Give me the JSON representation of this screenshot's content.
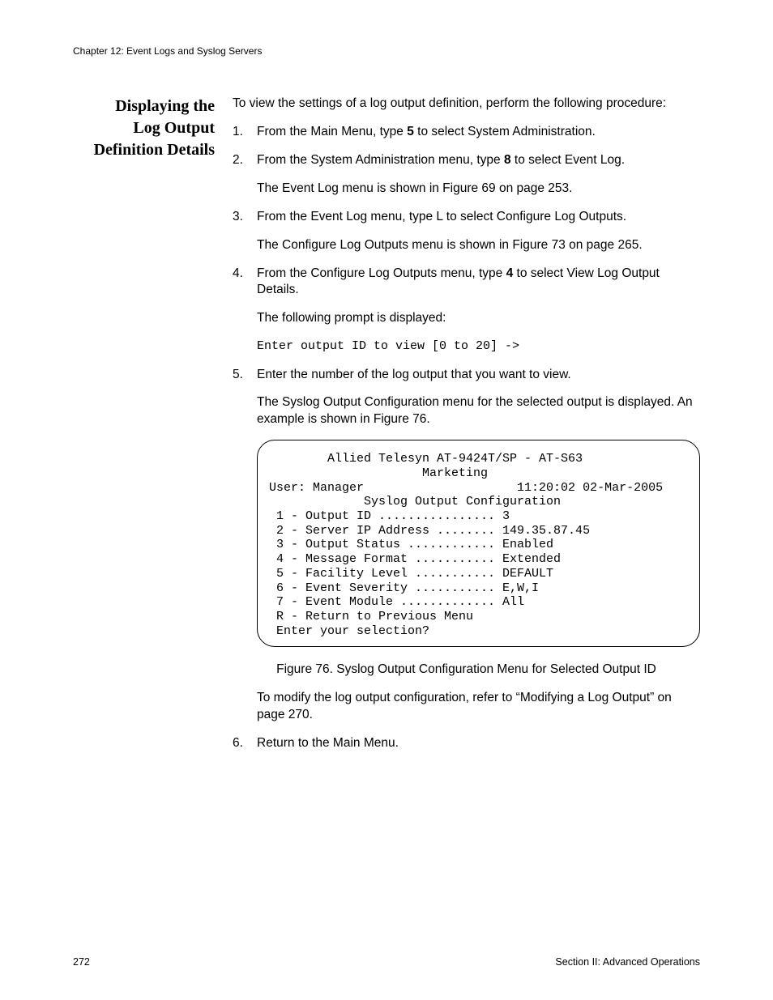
{
  "chapter_header": "Chapter 12: Event Logs and Syslog Servers",
  "sidehead_l1": "Displaying the",
  "sidehead_l2": "Log Output",
  "sidehead_l3": "Definition Details",
  "intro": "To view the settings of a log output definition, perform the following procedure:",
  "s1_num": "1.",
  "s1_a": "From the Main Menu, type ",
  "s1_b": "5",
  "s1_c": " to select System Administration.",
  "s2_num": "2.",
  "s2_a": "From the System Administration menu, type ",
  "s2_b": "8",
  "s2_c": " to select Event Log.",
  "s2_p2": "The Event Log menu is shown in Figure 69 on page 253.",
  "s3_num": "3.",
  "s3_p1": "From the Event Log menu, type L to select Configure Log Outputs.",
  "s3_p2": "The Configure Log Outputs menu is shown in Figure 73 on page 265.",
  "s4_num": "4.",
  "s4_a": "From the Configure Log Outputs menu, type ",
  "s4_b": "4",
  "s4_c": " to select View Log Output Details.",
  "s4_p2": "The following prompt is displayed:",
  "s4_code": "Enter output ID to view [0 to 20] ->",
  "s5_num": "5.",
  "s5_p1": "Enter the number of the log output that you want to view.",
  "s5_p2": "The Syslog Output Configuration menu for the selected output is displayed. An example is shown in Figure 76.",
  "term_l1": "        Allied Telesyn AT-9424T/SP - AT-S63",
  "term_l2": "                     Marketing",
  "term_l3": "User: Manager                     11:20:02 02-Mar-2005",
  "term_l4": "             Syslog Output Configuration",
  "term_l5": "",
  "term_l6": " 1 - Output ID ................ 3",
  "term_l7": " 2 - Server IP Address ........ 149.35.87.45",
  "term_l8": " 3 - Output Status ............ Enabled",
  "term_l9": " 4 - Message Format ........... Extended",
  "term_l10": " 5 - Facility Level ........... DEFAULT",
  "term_l11": " 6 - Event Severity ........... E,W,I",
  "term_l12": " 7 - Event Module ............. All",
  "term_l13": "",
  "term_l14": " R - Return to Previous Menu",
  "term_l15": "",
  "term_l16": " Enter your selection?",
  "fig_caption": "Figure 76. Syslog Output Configuration Menu for Selected Output ID",
  "s5_p3": "To modify the log output configuration, refer to “Modifying a Log Output” on page 270.",
  "s6_num": "6.",
  "s6_p1": "Return to the Main Menu.",
  "footer_left": "272",
  "footer_right": "Section II: Advanced Operations"
}
